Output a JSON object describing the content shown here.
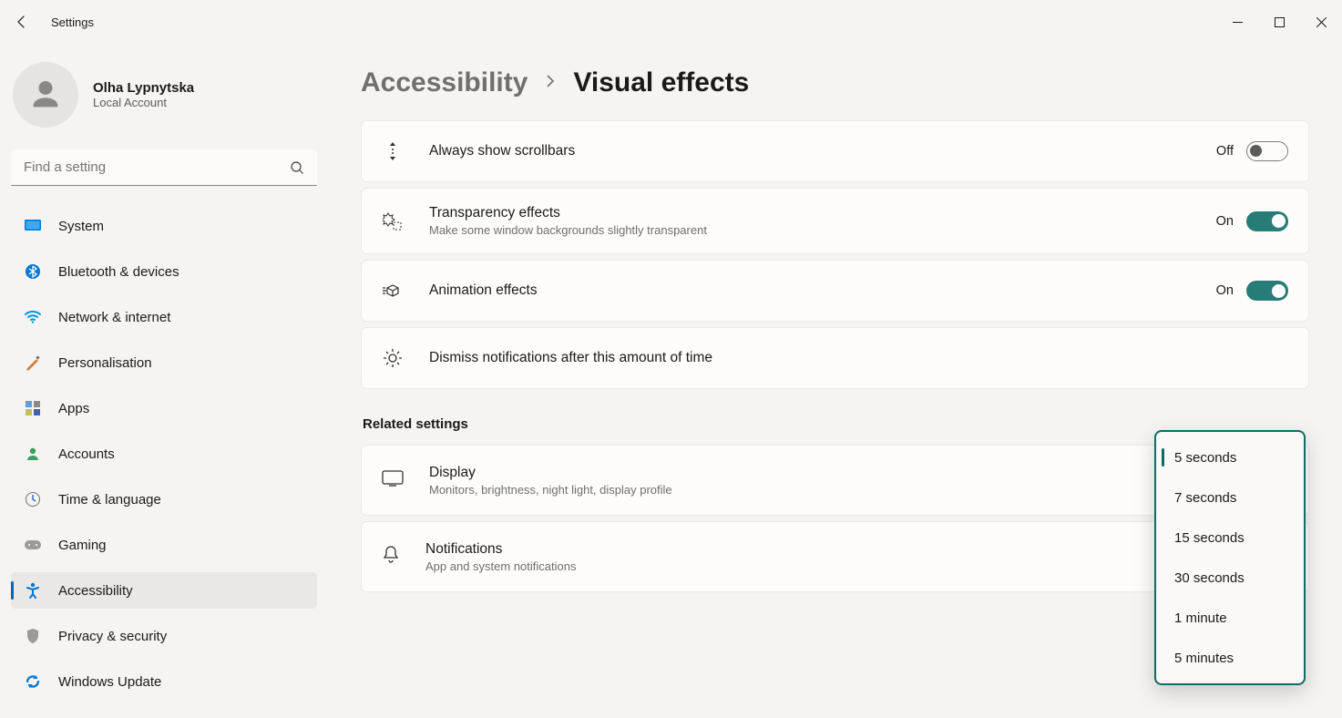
{
  "app": {
    "title": "Settings"
  },
  "account": {
    "name": "Olha Lypnytska",
    "sub": "Local Account"
  },
  "search": {
    "placeholder": "Find a setting"
  },
  "nav": {
    "items": [
      {
        "label": "System"
      },
      {
        "label": "Bluetooth & devices"
      },
      {
        "label": "Network & internet"
      },
      {
        "label": "Personalisation"
      },
      {
        "label": "Apps"
      },
      {
        "label": "Accounts"
      },
      {
        "label": "Time & language"
      },
      {
        "label": "Gaming"
      },
      {
        "label": "Accessibility"
      },
      {
        "label": "Privacy & security"
      },
      {
        "label": "Windows Update"
      }
    ]
  },
  "breadcrumb": {
    "parent": "Accessibility",
    "current": "Visual effects"
  },
  "settings": {
    "scrollbars": {
      "title": "Always show scrollbars",
      "state": "Off"
    },
    "transparency": {
      "title": "Transparency effects",
      "sub": "Make some window backgrounds slightly transparent",
      "state": "On"
    },
    "animation": {
      "title": "Animation effects",
      "state": "On"
    },
    "dismiss": {
      "title": "Dismiss notifications after this amount of time"
    }
  },
  "related": {
    "heading": "Related settings",
    "display": {
      "title": "Display",
      "sub": "Monitors, brightness, night light, display profile"
    },
    "notifications": {
      "title": "Notifications",
      "sub": "App and system notifications"
    }
  },
  "dropdown": {
    "options": [
      "5 seconds",
      "7 seconds",
      "15 seconds",
      "30 seconds",
      "1 minute",
      "5 minutes"
    ]
  }
}
